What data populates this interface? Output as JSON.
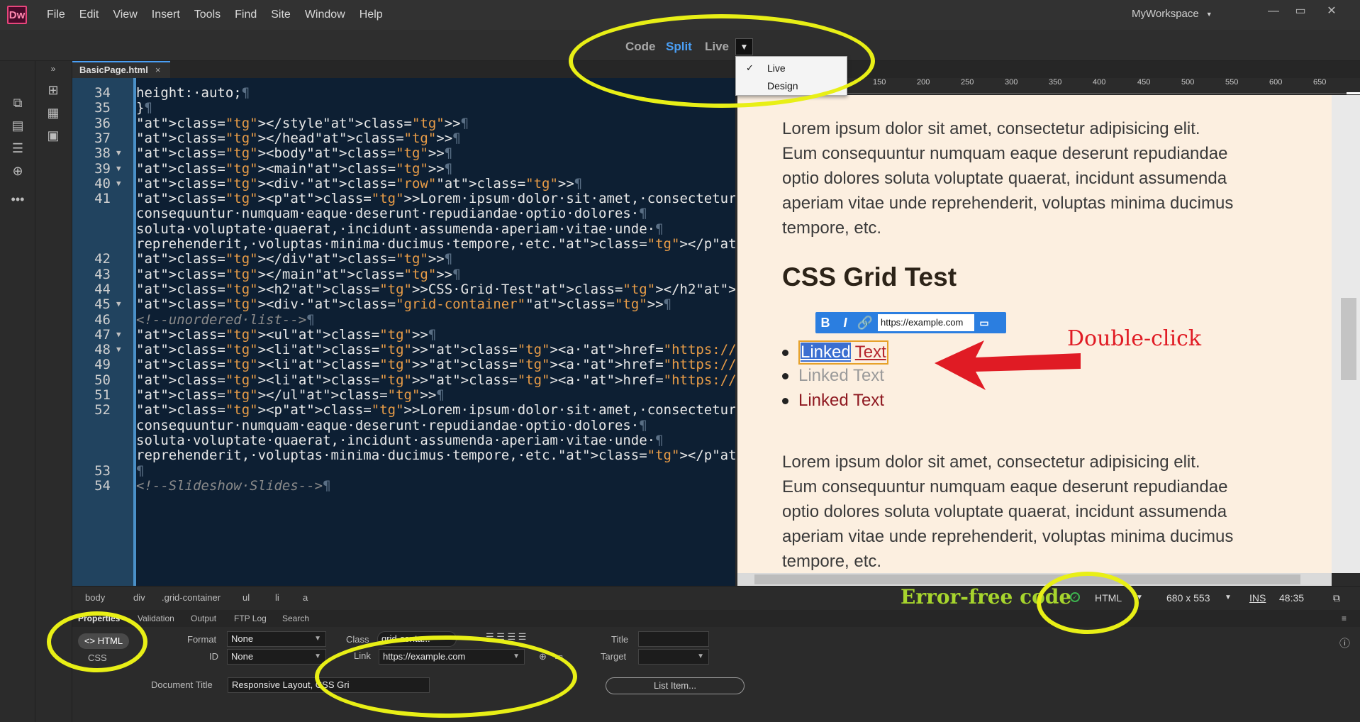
{
  "app": {
    "logo": "Dw",
    "workspace": "MyWorkspace"
  },
  "menu": [
    "File",
    "Edit",
    "View",
    "Insert",
    "Tools",
    "Find",
    "Site",
    "Window",
    "Help"
  ],
  "window_controls": {
    "minimize": "—",
    "restore": "▭",
    "close": "✕"
  },
  "views": {
    "code": "Code",
    "split": "Split",
    "live": "Live",
    "dropdown_options": [
      "Live",
      "Design"
    ]
  },
  "document_tab": {
    "name": "BasicPage.html",
    "close": "×"
  },
  "code": {
    "lines": [
      {
        "n": "34",
        "fold": false,
        "html": "height:·auto;"
      },
      {
        "n": "35",
        "fold": false,
        "html": "}"
      },
      {
        "n": "36",
        "fold": false,
        "html": "</style>"
      },
      {
        "n": "37",
        "fold": false,
        "html": "</head>"
      },
      {
        "n": "38",
        "fold": true,
        "html": "<body>"
      },
      {
        "n": "39",
        "fold": true,
        "html": "<main>"
      },
      {
        "n": "40",
        "fold": true,
        "html": "<div·class=\"row\">"
      },
      {
        "n": "41",
        "fold": false,
        "html": "<p>Lorem·ipsum·dolor·sit·amet,·consectetur·adipisicing·elit.·Eum·"
      },
      {
        "n": "",
        "fold": false,
        "html": "consequuntur·numquam·eaque·deserunt·repudiandae·optio·dolores·"
      },
      {
        "n": "",
        "fold": false,
        "html": "soluta·voluptate·quaerat,·incidunt·assumenda·aperiam·vitae·unde·"
      },
      {
        "n": "",
        "fold": false,
        "html": "reprehenderit,·voluptas·minima·ducimus·tempore,·etc.</p>"
      },
      {
        "n": "42",
        "fold": false,
        "html": "</div>"
      },
      {
        "n": "43",
        "fold": false,
        "html": "</main>"
      },
      {
        "n": "44",
        "fold": false,
        "html": "<h2>CSS·Grid·Test</h2>"
      },
      {
        "n": "45",
        "fold": true,
        "html": "<div·class=\"grid-container\">"
      },
      {
        "n": "46",
        "fold": false,
        "html": "<!--unordered·list-->"
      },
      {
        "n": "47",
        "fold": true,
        "html": "<ul>"
      },
      {
        "n": "48",
        "fold": true,
        "html": "<li><a·href=\"https://example.com\">Linked·Text</a></li>·"
      },
      {
        "n": "49",
        "fold": false,
        "html": "<li><a·href=\"https://google.com\">Linked·Text</a></li>·"
      },
      {
        "n": "50",
        "fold": false,
        "html": "<li><a·href=\"https://bing.com\">Linked·Text</a></li>"
      },
      {
        "n": "51",
        "fold": false,
        "html": "</ul>"
      },
      {
        "n": "52",
        "fold": false,
        "html": "<p>Lorem·ipsum·dolor·sit·amet,·consectetur·adipisicing·elit.·Eum·"
      },
      {
        "n": "",
        "fold": false,
        "html": "consequuntur·numquam·eaque·deserunt·repudiandae·optio·dolores·"
      },
      {
        "n": "",
        "fold": false,
        "html": "soluta·voluptate·quaerat,·incidunt·assumenda·aperiam·vitae·unde·"
      },
      {
        "n": "",
        "fold": false,
        "html": "reprehenderit,·voluptas·minima·ducimus·tempore,·etc.</p>"
      },
      {
        "n": "53",
        "fold": false,
        "html": ""
      },
      {
        "n": "54",
        "fold": false,
        "html": "<!--Slideshow·Slides-->"
      }
    ]
  },
  "ruler": [
    "150",
    "200",
    "250",
    "300",
    "350",
    "400",
    "450",
    "500",
    "550",
    "600",
    "650"
  ],
  "live": {
    "p1": [
      "Lorem ipsum dolor sit amet, consectetur adipisicing elit.",
      "Eum consequuntur numquam eaque deserunt repudiandae",
      "optio dolores soluta voluptate quaerat, incidunt assumenda",
      "aperiam vitae unde reprehenderit, voluptas minima ducimus",
      "tempore, etc."
    ],
    "h2": "CSS Grid Test",
    "editor_toolbar": {
      "bold": "B",
      "italic": "I",
      "url": "https://example.com"
    },
    "list": {
      "item1_selected": "Linked",
      "item1_rest": "Text",
      "item2": "Linked Text",
      "item3": "Linked Text"
    },
    "p2": [
      "Lorem ipsum dolor sit amet, consectetur adipisicing elit.",
      "Eum consequuntur numquam eaque deserunt repudiandae",
      "optio dolores soluta voluptate quaerat, incidunt assumenda",
      "aperiam vitae unde reprehenderit, voluptas minima ducimus",
      "tempore, etc."
    ]
  },
  "annotations": {
    "double_click": "Double-click",
    "error_free": "Error-free code"
  },
  "statusbar": {
    "breadcrumbs": [
      "body",
      "div",
      ".grid-container",
      "ul",
      "li",
      "a"
    ],
    "doc_type": "HTML",
    "dimensions": "680 x 553",
    "mode": "INS",
    "cursor": "48:35"
  },
  "panel_tabs": [
    "Properties",
    "Validation",
    "Output",
    "FTP Log",
    "Search"
  ],
  "properties": {
    "html_button": "HTML",
    "css_button": "CSS",
    "format_label": "Format",
    "format_value": "None",
    "id_label": "ID",
    "id_value": "None",
    "class_label": "Class",
    "class_value": "grid-conta...",
    "link_label": "Link",
    "link_value": "https://example.com",
    "title_label": "Title",
    "title_value": "",
    "target_label": "Target",
    "target_value": "",
    "doc_title_label": "Document Title",
    "doc_title_value": "Responsive Layout, CSS Gri",
    "list_item_button": "List Item..."
  },
  "colors": {
    "accent": "#4a9ff5",
    "annotation_yellow": "#e8ef16",
    "annotation_red": "#e01b24",
    "ok_green": "#3db34f"
  }
}
